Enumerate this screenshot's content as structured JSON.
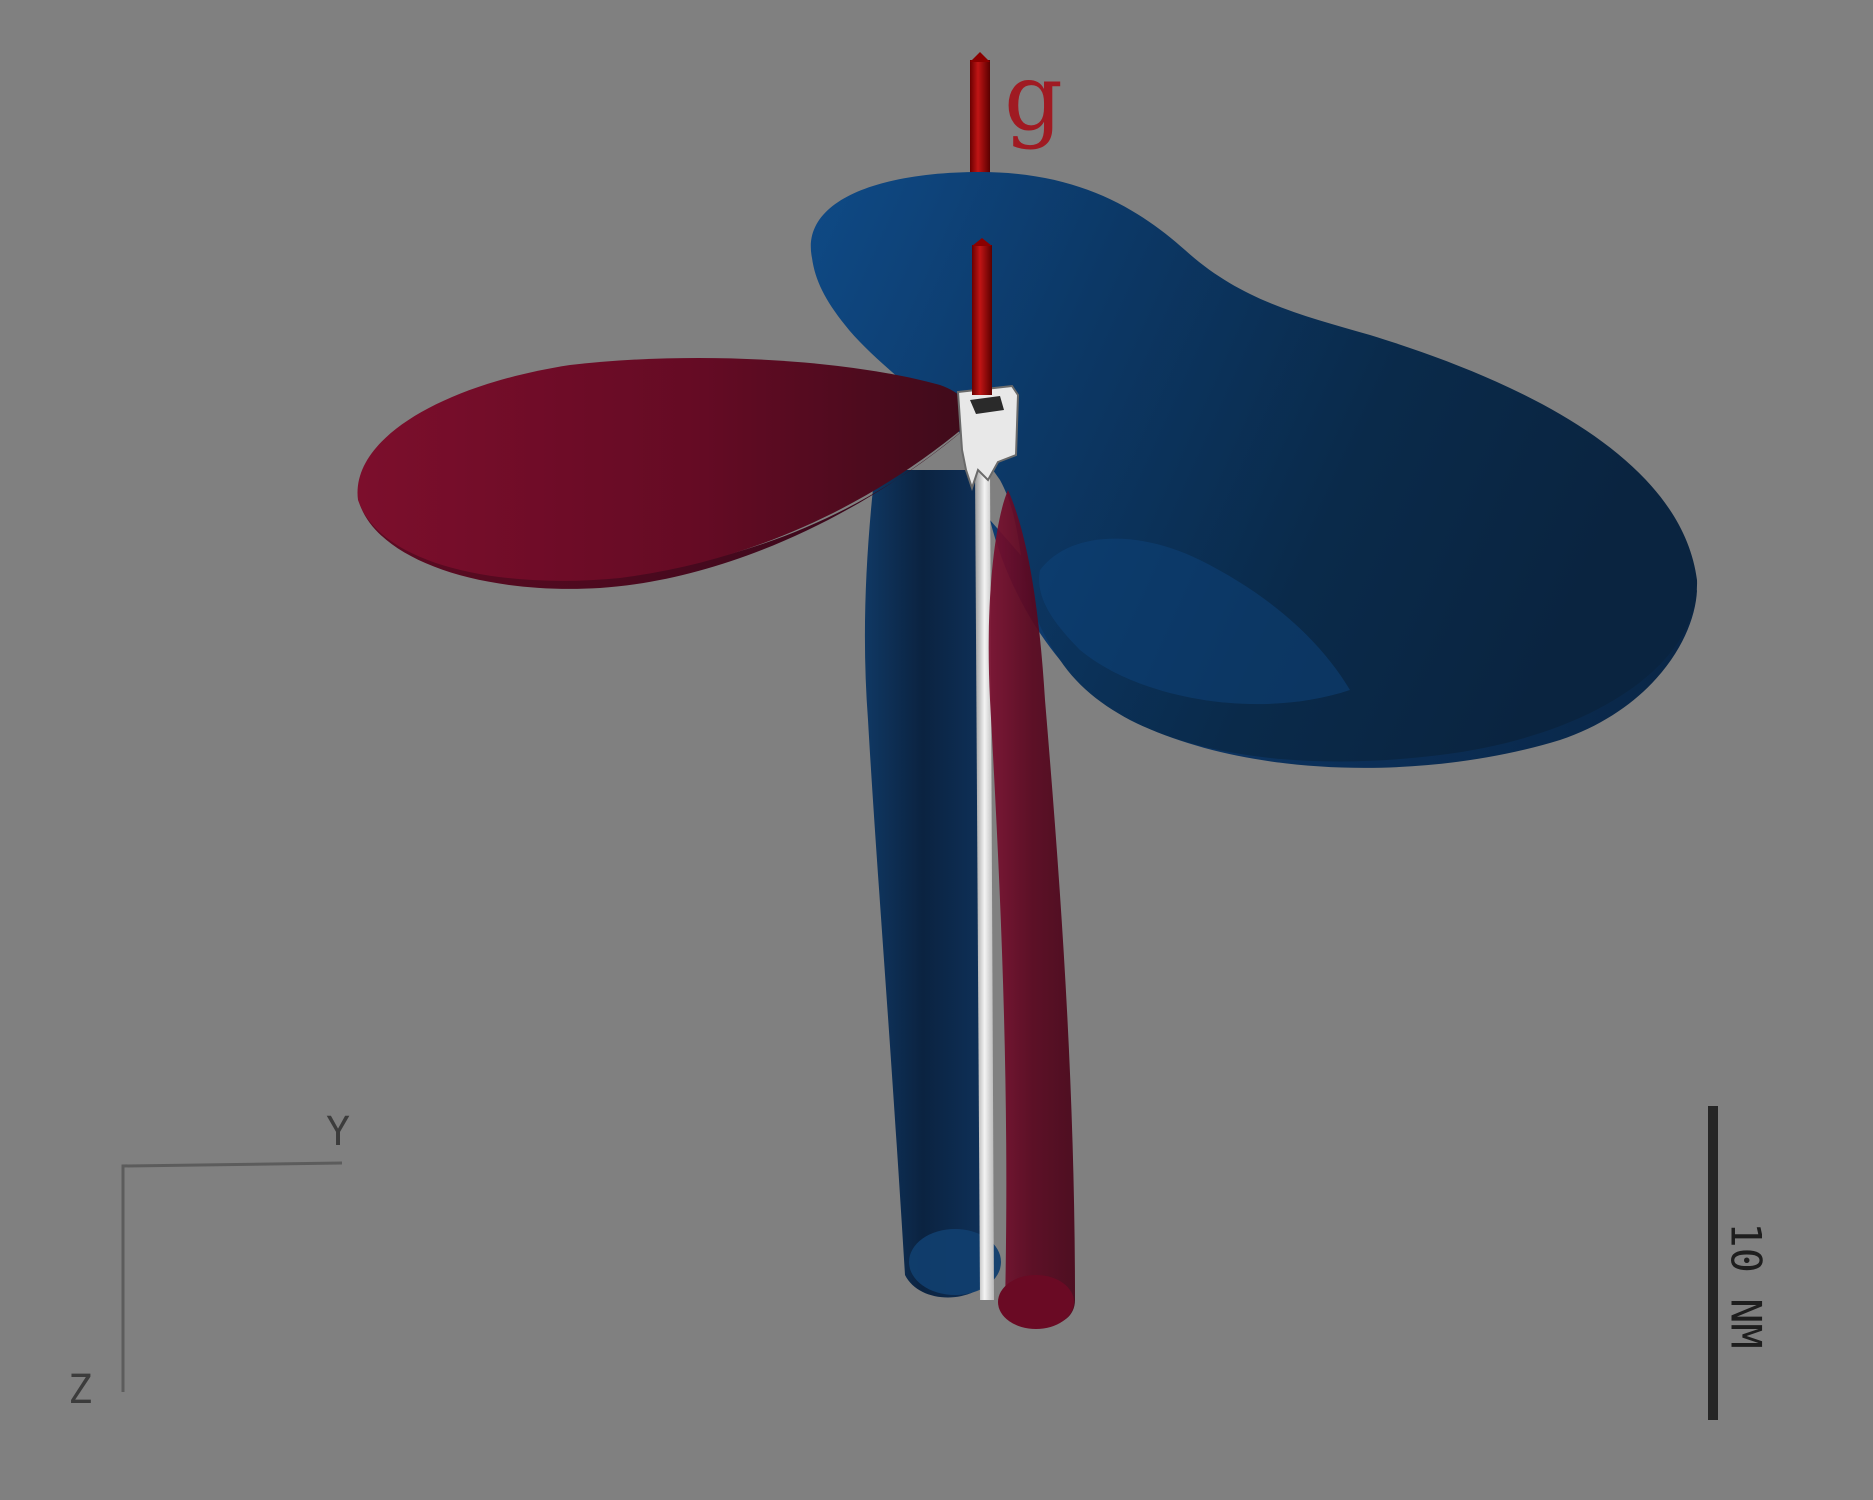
{
  "colors": {
    "background": "#808080",
    "red_lobe": "#7a0f2a",
    "blue_lobe": "#0d3a6e",
    "rod": "#a00d10"
  },
  "g_vector": {
    "label": "g"
  },
  "orientation_axes": {
    "y_label": "Y",
    "z_label": "Z"
  },
  "scale_bar": {
    "label": "10 NM"
  }
}
